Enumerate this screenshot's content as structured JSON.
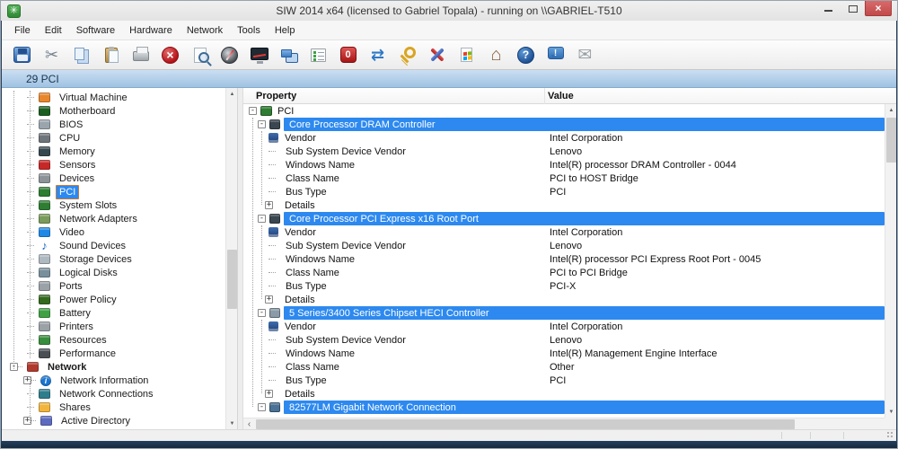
{
  "window": {
    "title": "SIW 2014 x64 (licensed to Gabriel Topala) - running on \\\\GABRIEL-T510",
    "app_icon": "siw-logo",
    "controls": {
      "minimize": "minimize",
      "maximize": "maximize",
      "close": "×"
    }
  },
  "menu": {
    "items": [
      "File",
      "Edit",
      "Software",
      "Hardware",
      "Network",
      "Tools",
      "Help"
    ]
  },
  "toolbar": {
    "buttons": [
      {
        "id": "save",
        "name": "save-icon"
      },
      {
        "id": "cut",
        "name": "cut-icon",
        "glyph": "✂"
      },
      {
        "id": "copy",
        "name": "copy-icon"
      },
      {
        "id": "paste",
        "name": "paste-icon"
      },
      {
        "id": "print",
        "name": "print-icon"
      },
      {
        "id": "stop",
        "name": "stop-icon",
        "glyph": "×"
      },
      {
        "id": "search",
        "name": "search-icon"
      },
      {
        "id": "compass",
        "name": "dashboard-icon"
      },
      {
        "id": "monitor",
        "name": "system-monitor-icon"
      },
      {
        "id": "workstations",
        "name": "remote-computers-icon"
      },
      {
        "id": "checklist",
        "name": "report-icon"
      },
      {
        "id": "power",
        "name": "power-icon",
        "glyph": "0"
      },
      {
        "id": "refresh",
        "name": "refresh-icon",
        "glyph": "⇄"
      },
      {
        "id": "key",
        "name": "license-key-icon"
      },
      {
        "id": "tools",
        "name": "tools-icon"
      },
      {
        "id": "windows",
        "name": "windows-update-icon"
      },
      {
        "id": "home",
        "name": "home-icon",
        "glyph": "⌂"
      },
      {
        "id": "help",
        "name": "help-icon",
        "glyph": "?"
      },
      {
        "id": "feedback",
        "name": "feedback-icon",
        "glyph": "!"
      },
      {
        "id": "mail",
        "name": "email-icon",
        "glyph": "✉"
      }
    ]
  },
  "panel_header": "29 PCI",
  "sidebar": {
    "items": [
      {
        "label": "Virtual Machine",
        "icon": "virtual-machine-icon",
        "color": "#E8862C",
        "depth": 1
      },
      {
        "label": "Motherboard",
        "icon": "motherboard-icon",
        "color": "#1B5E20",
        "depth": 1
      },
      {
        "label": "BIOS",
        "icon": "bios-icon",
        "color": "#9AA4AC",
        "depth": 1
      },
      {
        "label": "CPU",
        "icon": "cpu-icon",
        "color": "#6E757B",
        "depth": 1
      },
      {
        "label": "Memory",
        "icon": "memory-icon",
        "color": "#37474F",
        "depth": 1
      },
      {
        "label": "Sensors",
        "icon": "sensors-icon",
        "color": "#C62828",
        "depth": 1
      },
      {
        "label": "Devices",
        "icon": "devices-icon",
        "color": "#8D9499",
        "depth": 1
      },
      {
        "label": "PCI",
        "icon": "pci-icon",
        "color": "#2E7D32",
        "depth": 1,
        "selected": true
      },
      {
        "label": "System Slots",
        "icon": "system-slots-icon",
        "color": "#2E7D32",
        "depth": 1
      },
      {
        "label": "Network Adapters",
        "icon": "network-adapters-icon",
        "color": "#7A9B5A",
        "depth": 1
      },
      {
        "label": "Video",
        "icon": "video-icon",
        "color": "#1E88E5",
        "depth": 1
      },
      {
        "label": "Sound Devices",
        "icon": "sound-devices-icon",
        "color": "#1565C0",
        "depth": 1,
        "glyph": "♪",
        "noshape": true
      },
      {
        "label": "Storage Devices",
        "icon": "storage-devices-icon",
        "color": "#AEB9C0",
        "depth": 1
      },
      {
        "label": "Logical Disks",
        "icon": "logical-disks-icon",
        "color": "#78909C",
        "depth": 1
      },
      {
        "label": "Ports",
        "icon": "ports-icon",
        "color": "#9AA1A7",
        "depth": 1
      },
      {
        "label": "Power Policy",
        "icon": "power-policy-icon",
        "color": "#33691E",
        "depth": 1
      },
      {
        "label": "Battery",
        "icon": "battery-icon",
        "color": "#3FA044",
        "depth": 1
      },
      {
        "label": "Printers",
        "icon": "printers-icon",
        "color": "#9AA1A7",
        "depth": 1
      },
      {
        "label": "Resources",
        "icon": "resources-icon",
        "color": "#388E3C",
        "depth": 1
      },
      {
        "label": "Performance",
        "icon": "performance-icon",
        "color": "#4A4F55",
        "depth": 1
      },
      {
        "label": "Network",
        "icon": "network-group-icon",
        "color": "#B03A2E",
        "depth": 0,
        "bold": true,
        "expander": "-"
      },
      {
        "label": "Network Information",
        "icon": "network-information-icon",
        "color": "#1976D2",
        "depth": 1,
        "expander": "+",
        "glyph": "i",
        "circle": true
      },
      {
        "label": "Network Connections",
        "icon": "network-connections-icon",
        "color": "#2E7D8C",
        "depth": 1
      },
      {
        "label": "Shares",
        "icon": "shares-icon",
        "color": "#F2B53C",
        "depth": 1
      },
      {
        "label": "Active Directory",
        "icon": "active-directory-icon",
        "color": "#5C6BC0",
        "depth": 1,
        "expander": "+"
      }
    ]
  },
  "table": {
    "columns": [
      "Property",
      "Value"
    ],
    "root": {
      "label": "PCI",
      "icon": "pci-card-icon",
      "color": "#2F7D32",
      "expander": "-"
    },
    "devices": [
      {
        "name": "Core Processor DRAM Controller",
        "icon": "chip-icon",
        "color": "#3A4750",
        "properties": [
          {
            "label": "Vendor",
            "value": "Intel Corporation",
            "icon": "vendor-icon"
          },
          {
            "label": "Sub System Device Vendor",
            "value": "Lenovo"
          },
          {
            "label": "Windows Name",
            "value": "Intel(R) processor DRAM Controller - 0044"
          },
          {
            "label": "Class Name",
            "value": "PCI to HOST Bridge"
          },
          {
            "label": "Bus Type",
            "value": "PCI"
          }
        ],
        "details_label": "Details"
      },
      {
        "name": "Core Processor PCI Express x16 Root Port",
        "icon": "chip-icon",
        "color": "#3A4750",
        "properties": [
          {
            "label": "Vendor",
            "value": "Intel Corporation",
            "icon": "vendor-icon"
          },
          {
            "label": "Sub System Device Vendor",
            "value": "Lenovo"
          },
          {
            "label": "Windows Name",
            "value": "Intel(R) processor PCI Express Root Port - 0045"
          },
          {
            "label": "Class Name",
            "value": "PCI to PCI Bridge"
          },
          {
            "label": "Bus Type",
            "value": "PCI-X"
          }
        ],
        "details_label": "Details"
      },
      {
        "name": "5 Series/3400 Series Chipset HECI Controller",
        "icon": "port-icon",
        "color": "#8A9BA8",
        "properties": [
          {
            "label": "Vendor",
            "value": "Intel Corporation",
            "icon": "vendor-icon"
          },
          {
            "label": "Sub System Device Vendor",
            "value": "Lenovo"
          },
          {
            "label": "Windows Name",
            "value": "Intel(R) Management Engine Interface"
          },
          {
            "label": "Class Name",
            "value": "Other"
          },
          {
            "label": "Bus Type",
            "value": "PCI"
          }
        ],
        "details_label": "Details"
      }
    ],
    "partial_device": {
      "name": "82577LM Gigabit Network Connection",
      "icon": "network-icon",
      "color": "#4A7296"
    }
  },
  "colors": {
    "selection_blue": "#2D89EF",
    "panel_header_top": "#CBDFF2",
    "panel_header_bottom": "#9FC2E2",
    "close_button_red": "#C14A4A",
    "frame_navy": "#24405E"
  }
}
